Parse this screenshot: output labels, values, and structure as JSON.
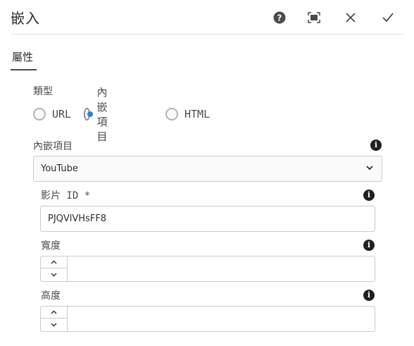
{
  "dialog": {
    "title": "嵌入",
    "actions": {
      "help_icon": "help-icon",
      "fullscreen_icon": "fullscreen-icon",
      "cancel_icon": "close-icon",
      "done_icon": "checkmark-icon"
    }
  },
  "tabs": [
    {
      "label": "屬性",
      "selected": true
    }
  ],
  "type_field": {
    "label": "類型",
    "options": [
      {
        "label": "URL",
        "checked": false
      },
      {
        "label": "內嵌項目",
        "checked": true
      },
      {
        "label": "HTML",
        "checked": false
      }
    ]
  },
  "embeddable_field": {
    "label": "內嵌項目",
    "selected": "YouTube"
  },
  "video_id_field": {
    "label": "影片 ID *",
    "value": "PJQVlVHsFF8"
  },
  "width_field": {
    "label": "寬度",
    "value": ""
  },
  "height_field": {
    "label": "高度",
    "value": ""
  },
  "colors": {
    "accent": "#2680eb",
    "border": "#cacaca",
    "text": "#4b4b4b"
  }
}
